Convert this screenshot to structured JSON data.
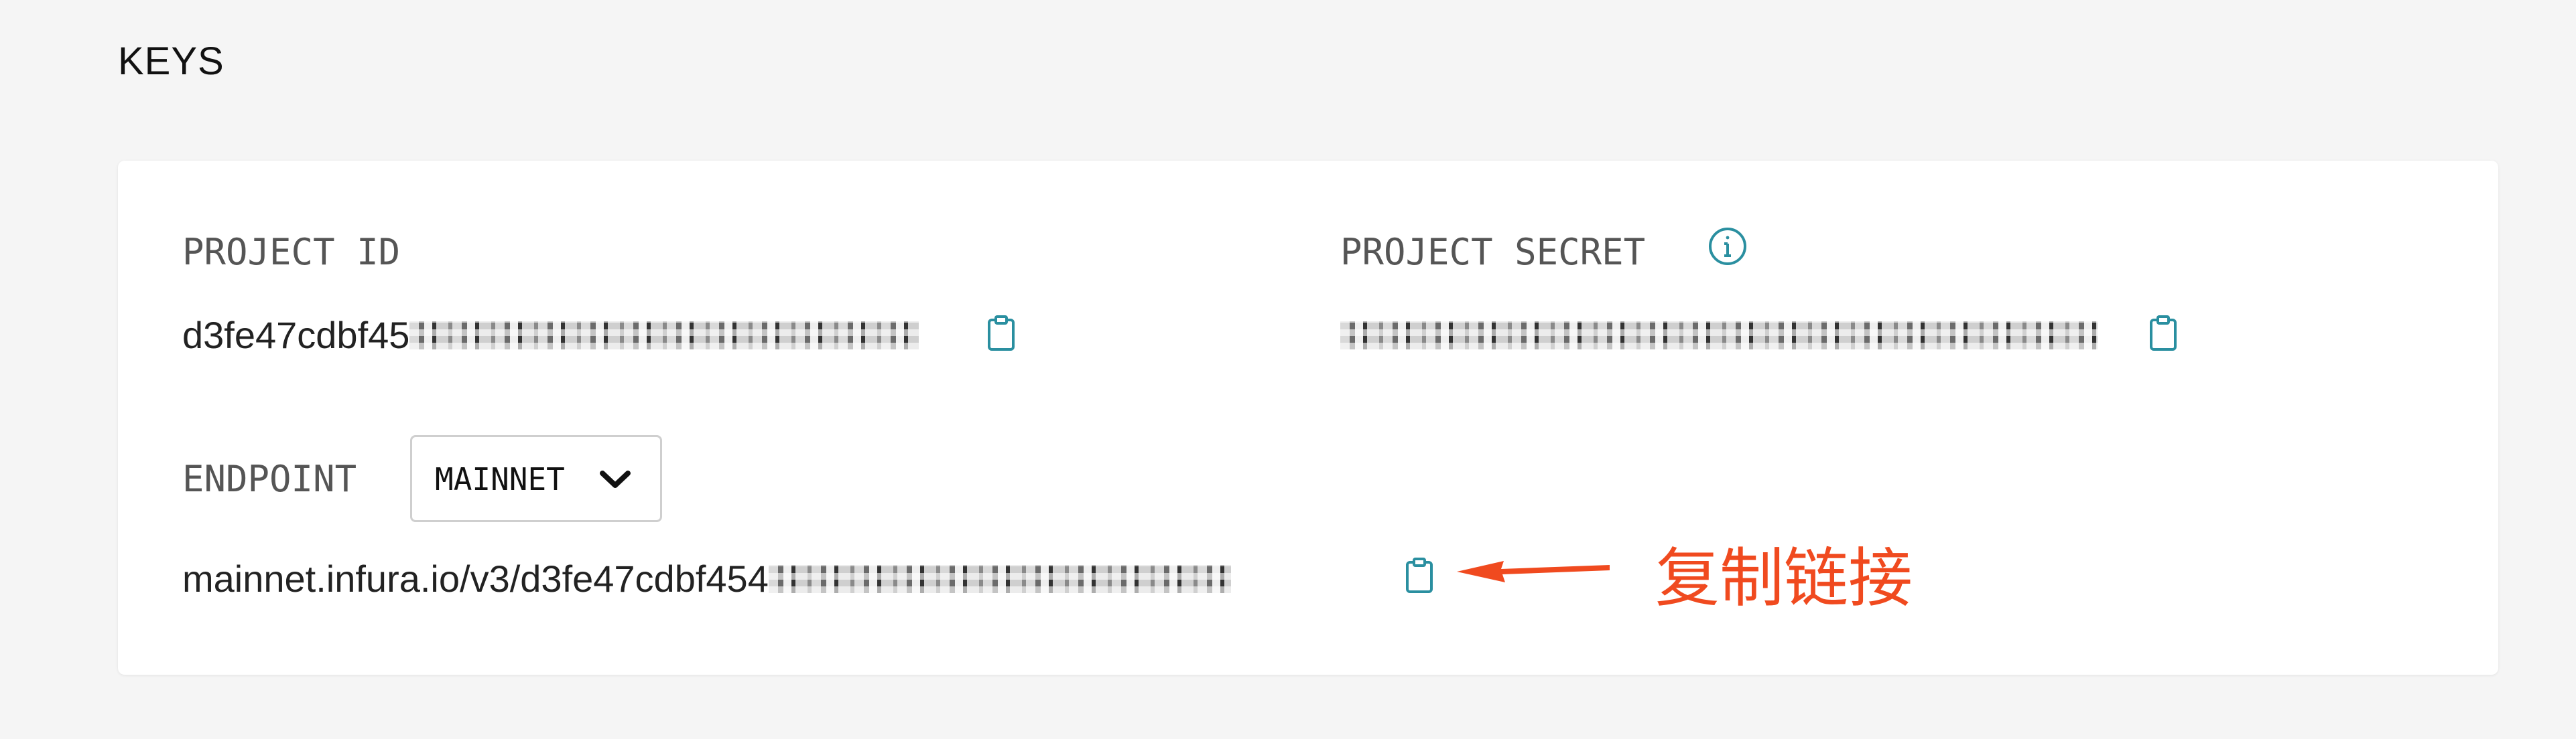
{
  "section": {
    "title": "KEYS"
  },
  "project_id": {
    "label": "PROJECT ID",
    "value_visible": "d3fe47cdbf45"
  },
  "project_secret": {
    "label": "PROJECT SECRET"
  },
  "endpoint": {
    "label": "ENDPOINT",
    "network_selected": "MAINNET",
    "url_visible": "mainnet.infura.io/v3/d3fe47cdbf454"
  },
  "annotation": {
    "text": "复制链接",
    "color": "#f04a1f"
  },
  "colors": {
    "accent": "#2a8fa0",
    "background": "#f5f5f5",
    "card": "#ffffff"
  },
  "icons": {
    "copy": "clipboard-icon",
    "info": "info-icon",
    "dropdown": "chevron-down-icon"
  }
}
